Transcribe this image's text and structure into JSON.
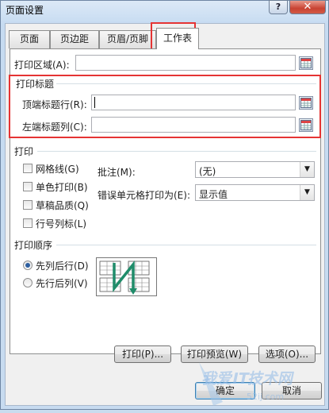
{
  "window": {
    "title": "页面设置",
    "help": "?",
    "close": "✕"
  },
  "tabs": [
    {
      "label": "页面"
    },
    {
      "label": "页边距"
    },
    {
      "label": "页眉/页脚"
    },
    {
      "label": "工作表"
    }
  ],
  "print_area": {
    "label": "打印区域(A):",
    "value": ""
  },
  "print_titles": {
    "group": "打印标题",
    "rows_label": "顶端标题行(R):",
    "cols_label": "左端标题列(C):",
    "rows_value": "",
    "cols_value": ""
  },
  "print": {
    "group": "打印",
    "gridlines": "网格线(G)",
    "black_white": "单色打印(B)",
    "draft": "草稿品质(Q)",
    "row_col_headings": "行号列标(L)",
    "comments_label": "批注(M):",
    "comments_value": "(无)",
    "errors_label": "错误单元格打印为(E):",
    "errors_value": "显示值"
  },
  "page_order": {
    "group": "打印顺序",
    "down_then_over": "先列后行(D)",
    "over_then_down": "先行后列(V)",
    "selected": "down_then_over"
  },
  "buttons": {
    "print": "打印(P)...",
    "preview": "打印预览(W)",
    "options": "选项(O)...",
    "ok": "确定",
    "cancel": "取消"
  },
  "watermark": {
    "text": "我爱IT技术网",
    "sub": "52ij.com"
  },
  "colors": {
    "highlight": "#e53434",
    "title_bar": "#c6dbf1"
  }
}
